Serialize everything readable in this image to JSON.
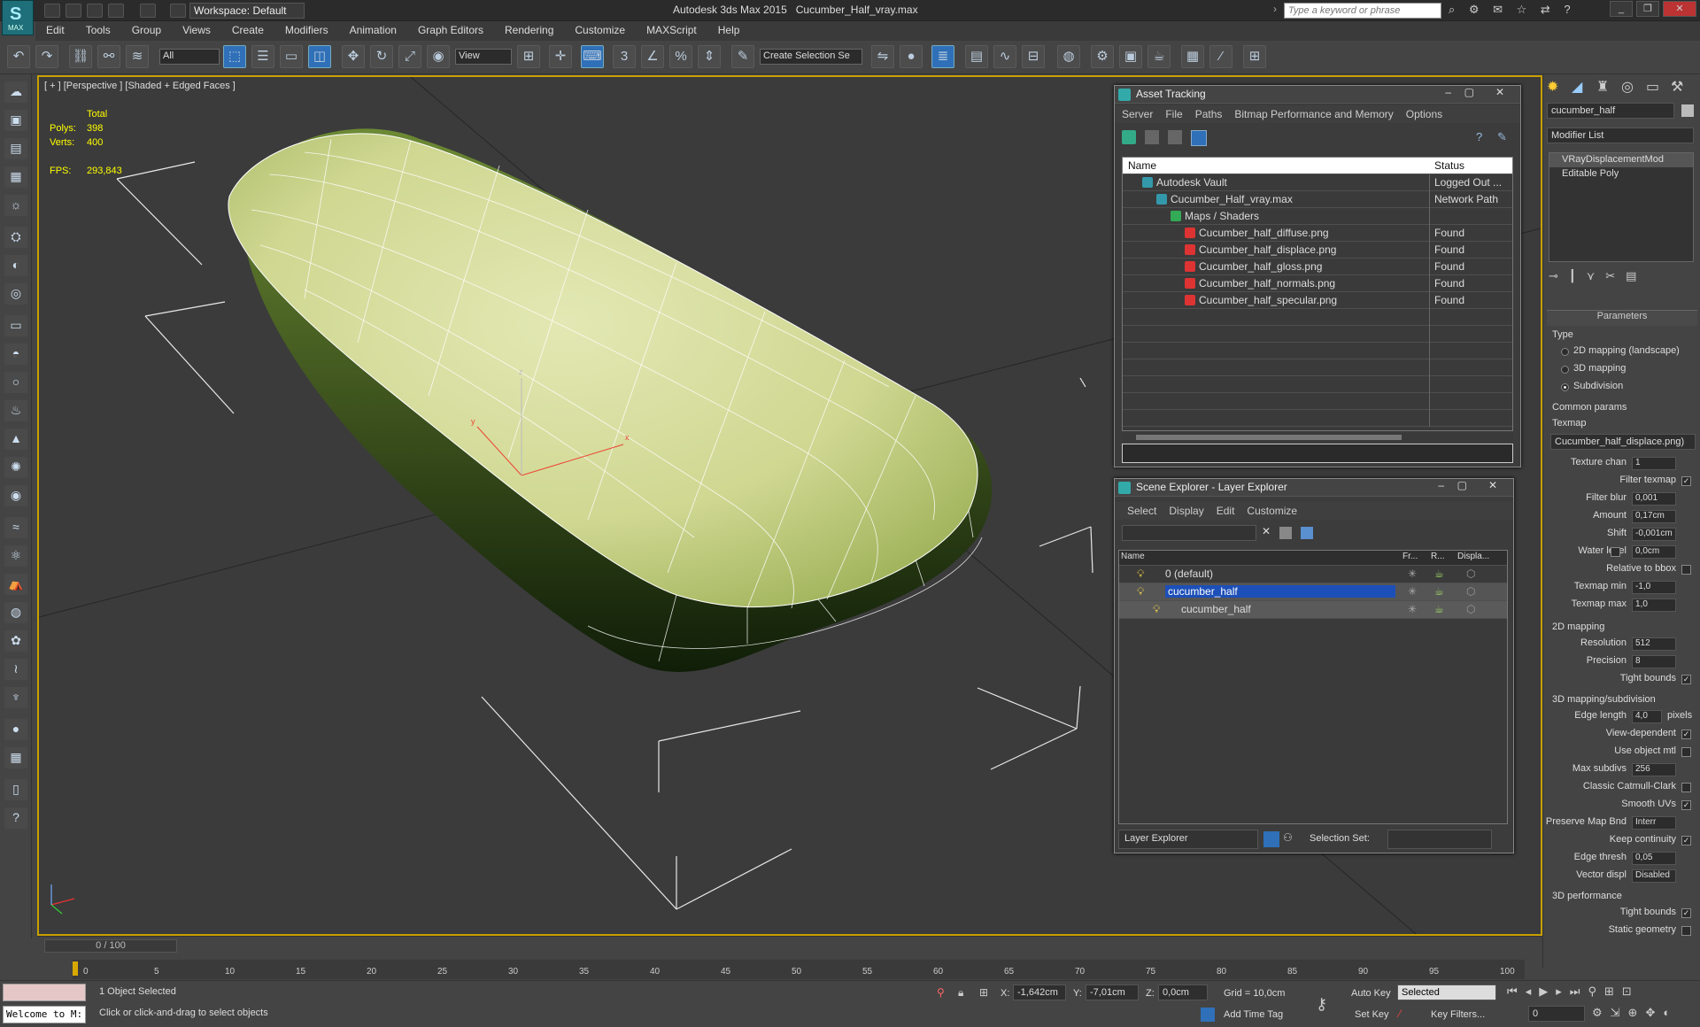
{
  "app": {
    "title": "Autodesk 3ds Max 2015",
    "file": "Cucumber_Half_vray.max",
    "logo": "MAX",
    "workspace": "Workspace: Default",
    "search_placeholder": "Type a keyword or phrase"
  },
  "menu": [
    "Edit",
    "Tools",
    "Group",
    "Views",
    "Create",
    "Modifiers",
    "Animation",
    "Graph Editors",
    "Rendering",
    "Customize",
    "MAXScript",
    "Help"
  ],
  "toolbar": {
    "filter": "All",
    "ref_coord": "View",
    "selection_set": "Create Selection Se"
  },
  "viewport": {
    "label": "[ + ] [Perspective ] [Shaded + Edged Faces ]",
    "stats": {
      "header": "Total",
      "polys_label": "Polys:",
      "polys": "398",
      "verts_label": "Verts:",
      "verts": "400",
      "fps_label": "FPS:",
      "fps": "293,843"
    },
    "gizmo": {
      "x": "x",
      "y": "y",
      "z": "z"
    }
  },
  "asset_tracking": {
    "title": "Asset Tracking",
    "menu": [
      "Server",
      "File",
      "Paths",
      "Bitmap Performance and Memory",
      "Options"
    ],
    "columns": [
      "Name",
      "Status"
    ],
    "rows": [
      {
        "name": "Autodesk Vault",
        "status": "Logged Out ...",
        "level": 0
      },
      {
        "name": "Cucumber_Half_vray.max",
        "status": "Network Path",
        "level": 1
      },
      {
        "name": "Maps / Shaders",
        "status": "",
        "level": 2
      },
      {
        "name": "Cucumber_half_diffuse.png",
        "status": "Found",
        "level": 3
      },
      {
        "name": "Cucumber_half_displace.png",
        "status": "Found",
        "level": 3
      },
      {
        "name": "Cucumber_half_gloss.png",
        "status": "Found",
        "level": 3
      },
      {
        "name": "Cucumber_half_normals.png",
        "status": "Found",
        "level": 3
      },
      {
        "name": "Cucumber_half_specular.png",
        "status": "Found",
        "level": 3
      }
    ]
  },
  "scene_explorer": {
    "title": "Scene Explorer - Layer Explorer",
    "menu": [
      "Select",
      "Display",
      "Edit",
      "Customize"
    ],
    "columns": [
      "Name",
      "Fr...",
      "R...",
      "Displa..."
    ],
    "rows": [
      {
        "name": "0 (default)",
        "selected": false,
        "level": 0
      },
      {
        "name": "cucumber_half",
        "selected": true,
        "level": 0
      },
      {
        "name": "cucumber_half",
        "selected": false,
        "level": 1
      }
    ],
    "footer_mode": "Layer Explorer",
    "selection_set_label": "Selection Set:"
  },
  "command_panel": {
    "object_name": "cucumber_half",
    "modifier_list": "Modifier List",
    "stack": [
      "VRayDisplacementMod",
      "Editable Poly"
    ],
    "rollout": "Parameters",
    "type_label": "Type",
    "types": [
      "2D mapping (landscape)",
      "3D mapping",
      "Subdivision"
    ],
    "selected_type": 2,
    "common_params": "Common params",
    "texmap_label": "Texmap",
    "texmap": "Cucumber_half_displace.png)",
    "params": [
      {
        "label": "Texture chan",
        "value": "1"
      },
      {
        "label": "Filter texmap",
        "check": true
      },
      {
        "label": "Filter blur",
        "value": "0,001"
      },
      {
        "label": "Amount",
        "value": "0,17cm"
      },
      {
        "label": "Shift",
        "value": "-0,001cm"
      },
      {
        "label": "Water level",
        "value": "0,0cm",
        "check": false
      },
      {
        "label": "Relative to bbox",
        "check": false
      },
      {
        "label": "Texmap min",
        "value": "-1,0"
      },
      {
        "label": "Texmap max",
        "value": "1,0"
      }
    ],
    "mapping2d_title": "2D mapping",
    "mapping2d": [
      {
        "label": "Resolution",
        "value": "512"
      },
      {
        "label": "Precision",
        "value": "8"
      },
      {
        "label": "Tight bounds",
        "check": true
      }
    ],
    "mapping3d_title": "3D mapping/subdivision",
    "edge_length_label": "Edge length",
    "edge_length": "4,0",
    "pixels": "pixels",
    "mapping3d": [
      {
        "label": "View-dependent",
        "check": true
      },
      {
        "label": "Use object mtl",
        "check": false
      },
      {
        "label": "Max subdivs",
        "value": "256"
      },
      {
        "label": "Classic Catmull-Clark",
        "check": false
      },
      {
        "label": "Smooth UVs",
        "check": true
      },
      {
        "label": "Preserve Map Bnd",
        "value": "Interr"
      },
      {
        "label": "Keep continuity",
        "check": true
      },
      {
        "label": "Edge thresh",
        "value": "0,05"
      },
      {
        "label": "Vector displ",
        "value": "Disabled"
      }
    ],
    "perf_title": "3D performance",
    "perf": [
      {
        "label": "Tight bounds",
        "check": true
      },
      {
        "label": "Static geometry",
        "check": false
      }
    ]
  },
  "timeline": {
    "frame": "0 / 100",
    "ticks": [
      "0",
      "5",
      "10",
      "15",
      "20",
      "25",
      "30",
      "35",
      "40",
      "45",
      "50",
      "55",
      "60",
      "65",
      "70",
      "75",
      "80",
      "85",
      "90",
      "95",
      "100"
    ]
  },
  "status": {
    "welcome": "Welcome to M:",
    "selected": "1 Object Selected",
    "prompt": "Click or click-and-drag to select objects",
    "x_label": "X:",
    "x": "-1,642cm",
    "y_label": "Y:",
    "y": "-7,01cm",
    "z_label": "Z:",
    "z": "0,0cm",
    "grid": "Grid = 10,0cm",
    "add_time_tag": "Add Time Tag",
    "auto_key": "Auto Key",
    "key_mode": "Selected",
    "set_key": "Set Key",
    "key_filters": "Key Filters...",
    "frame": "0"
  }
}
